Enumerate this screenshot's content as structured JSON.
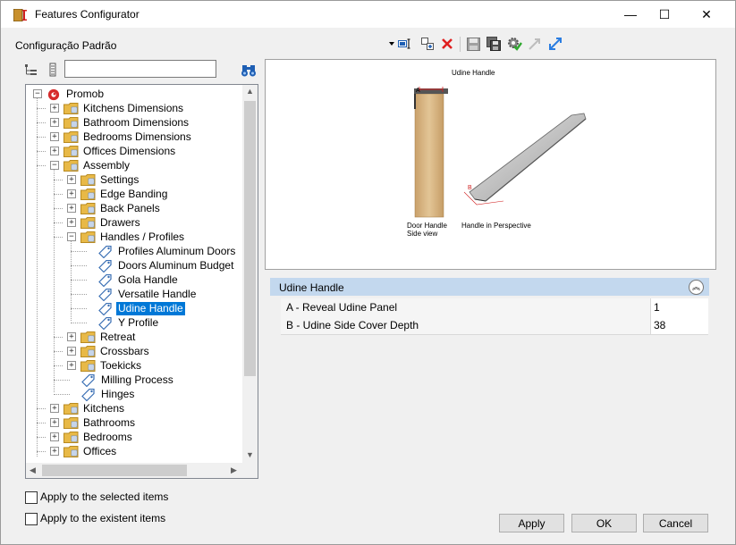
{
  "window": {
    "title": "Features Configurator",
    "minimize": "—",
    "maximize": "☐",
    "close": "✕"
  },
  "config_label": "Configuração Padrão",
  "search": {
    "value": "",
    "placeholder": ""
  },
  "tree": {
    "root": "Promob",
    "items": [
      "Kitchens Dimensions",
      "Bathroom Dimensions",
      "Bedrooms Dimensions",
      "Offices Dimensions",
      "Assembly",
      "Settings",
      "Edge Banding",
      "Back Panels",
      "Drawers",
      "Handles / Profiles",
      "Profiles Aluminum Doors",
      "Doors Aluminum Budget",
      "Gola Handle",
      "Versatile Handle",
      "Udine Handle",
      "Y Profile",
      "Retreat",
      "Crossbars",
      "Toekicks",
      "Milling Process",
      "Hinges",
      "Kitchens",
      "Bathrooms",
      "Bedrooms",
      "Offices"
    ],
    "selected": "Udine Handle"
  },
  "preview": {
    "title": "Udine Handle",
    "label_side_1": "Door Handle",
    "label_side_2": "Side view",
    "label_persp": "Handle in Perspective",
    "mark_a": "A",
    "mark_b": "B"
  },
  "property_grid": {
    "header": "Udine Handle",
    "rows": [
      {
        "name": "A - Reveal Udine Panel",
        "value": "1"
      },
      {
        "name": "B - Udine Side Cover Depth",
        "value": "38"
      }
    ]
  },
  "footer": {
    "apply_selected": "Apply to the selected items",
    "apply_existent": "Apply to the existent items",
    "apply": "Apply",
    "ok": "OK",
    "cancel": "Cancel"
  },
  "colors": {
    "selection": "#0078d7",
    "pg_header": "#c3d8ee",
    "folder": "#e8b947",
    "delete_red": "#e02020"
  }
}
